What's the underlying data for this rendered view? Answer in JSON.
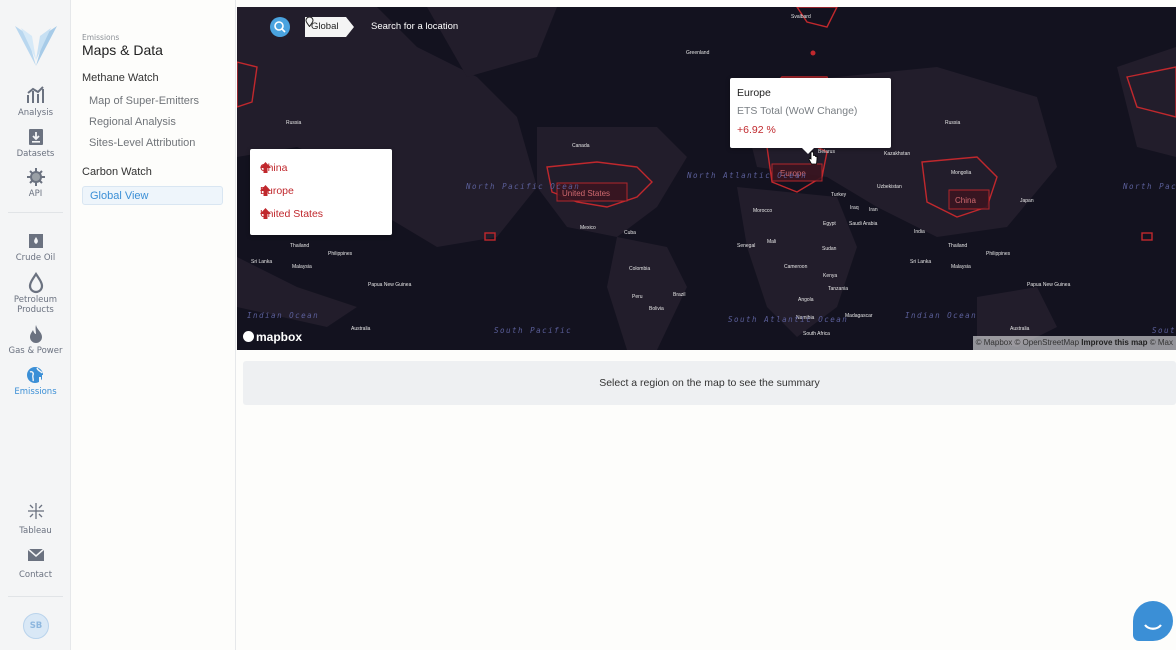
{
  "rail": {
    "items": [
      {
        "label": "Analysis",
        "icon": "analysis-icon"
      },
      {
        "label": "Datasets",
        "icon": "datasets-icon"
      },
      {
        "label": "API",
        "icon": "api-icon"
      },
      {
        "label": "Crude Oil",
        "icon": "crude-oil-icon"
      },
      {
        "label": "Petroleum Products",
        "icon": "petroleum-icon"
      },
      {
        "label": "Gas & Power",
        "icon": "gas-power-icon"
      },
      {
        "label": "Emissions",
        "icon": "emissions-icon",
        "active": true
      },
      {
        "label": "Tableau",
        "icon": "tableau-icon"
      },
      {
        "label": "Contact",
        "icon": "mail-icon"
      }
    ],
    "avatar_initials": "SB",
    "accent": "#3b8fd6"
  },
  "subnav": {
    "kicker": "Emissions",
    "title": "Maps & Data",
    "groups": [
      {
        "label": "Methane Watch",
        "links": [
          "Map of Super-Emitters",
          "Regional Analysis",
          "Sites-Level Attribution"
        ]
      },
      {
        "label": "Carbon Watch",
        "links": [
          "Global View"
        ]
      }
    ],
    "active_link": "Global View"
  },
  "map": {
    "search_chip": "Global",
    "search_placeholder": "Search for a location",
    "legend": [
      {
        "label": "China",
        "direction": "up"
      },
      {
        "label": "Europe",
        "direction": "up"
      },
      {
        "label": "United States",
        "direction": "up"
      }
    ],
    "tooltip": {
      "region": "Europe",
      "metric": "ETS Total (WoW Change)",
      "value": "+6.92 %"
    },
    "region_labels": [
      "United States",
      "Europe",
      "China"
    ],
    "place_labels": {
      "svalbard": "Svalbard",
      "greenland": "Greenland",
      "russia_left": "Russia",
      "russia_right": "Russia",
      "canada": "Canada",
      "belarus": "Belarus",
      "kazakhstan": "Kazakhstan",
      "mongolia": "Mongolia",
      "uzbekistan": "Uzbekistan",
      "turkey": "Turkey",
      "japan": "Japan",
      "morocco": "Morocco",
      "iraq": "Iraq",
      "iran": "Iran",
      "egypt": "Egypt",
      "saudi": "Saudi Arabia",
      "india": "India",
      "mexico": "Mexico",
      "cuba": "Cuba",
      "senegal": "Senegal",
      "mali": "Mali",
      "sudan": "Sudan",
      "thailand_left": "Thailand",
      "thailand_right": "Thailand",
      "philippines_left": "Philippines",
      "philippines_right": "Philippines",
      "srilanka_left": "Sri Lanka",
      "srilanka_right": "Sri Lanka",
      "malaysia_left": "Malaysia",
      "malaysia_right": "Malaysia",
      "colombia": "Colombia",
      "cameroon": "Cameroon",
      "kenya": "Kenya",
      "tanzania": "Tanzania",
      "peru": "Peru",
      "brazil": "Brazil",
      "bolivia": "Bolivia",
      "angola": "Angola",
      "namibia": "Namibia",
      "madagascar": "Madagascar",
      "south_africa": "South Africa",
      "png_left": "Papua New Guinea",
      "png_right": "Papua New Guinea",
      "australia_left": "Australia",
      "australia_right": "Australia"
    },
    "ocean_labels": {
      "north_pacific_left": "North Pacific Ocean",
      "north_pacific_right": "North Pacific Ocean",
      "north_atlantic": "North Atlantic Ocean",
      "indian_left": "Indian Ocean",
      "indian_right": "Indian Ocean",
      "south_pacific": "South Pacific",
      "south_atlantic": "South Atlantic Ocean",
      "south_right": "Sout"
    },
    "logo_text": "mapbox",
    "attribution_prefix": "© Mapbox © OpenStreetMap",
    "attribution_link": "Improve this map",
    "attribution_suffix": "© Max",
    "highlight_color": "#c0282d",
    "land_color": "#221d2b",
    "water_color": "#13121f"
  },
  "summary": {
    "text": "Select a region on the map to see the summary"
  }
}
